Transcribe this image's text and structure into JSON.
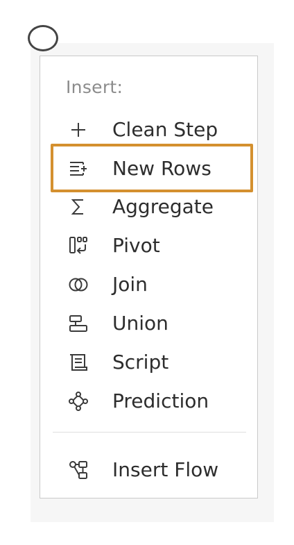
{
  "menu": {
    "header": "Insert:",
    "items": [
      {
        "label": "Clean Step",
        "icon": "plus-icon"
      },
      {
        "label": "New Rows",
        "icon": "new-rows-icon"
      },
      {
        "label": "Aggregate",
        "icon": "sigma-icon"
      },
      {
        "label": "Pivot",
        "icon": "pivot-icon"
      },
      {
        "label": "Join",
        "icon": "join-icon"
      },
      {
        "label": "Union",
        "icon": "union-icon"
      },
      {
        "label": "Script",
        "icon": "script-icon"
      },
      {
        "label": "Prediction",
        "icon": "prediction-icon"
      }
    ],
    "footer_item": {
      "label": "Insert Flow",
      "icon": "insert-flow-icon"
    }
  },
  "highlight_color": "#d4902f"
}
